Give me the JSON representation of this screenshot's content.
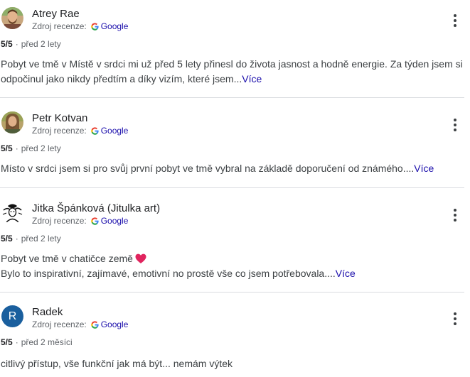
{
  "common": {
    "source_label": "Zdroj recenze:",
    "google_label": "Google",
    "more_label": "Více",
    "colors": {
      "link": "#1a0dab",
      "text": "#202124",
      "secondary": "#5f6368",
      "avatar_radek": "#1a5f9e"
    }
  },
  "reviews": [
    {
      "name": "Atrey Rae",
      "rating": "5/5",
      "time": "před 2 lety",
      "text_line1": "Pobyt ve tmě v Místě v srdci mi už před 5 lety přinesl do života jasnost a hodně energie. Za týden jsem si",
      "text_line2": "odpočinul jako nikdy předtím a díky vizím, které jsem",
      "ellipsis": "...",
      "avatar_icon": "man-beard-photo"
    },
    {
      "name": "Petr Kotvan",
      "rating": "5/5",
      "time": "před 2 lety",
      "text_line1": "Místo v srdci jsem si pro svůj první pobyt ve tmě vybral na základě doporučení od známého.",
      "ellipsis": "...",
      "avatar_icon": "man-long-hair-photo"
    },
    {
      "name": "Jitka Špánková (Jitulka art)",
      "rating": "5/5",
      "time": "před 2 lety",
      "text_line1": "Pobyt ve tmě v chatičce země",
      "text_line2": "Bylo to inspirativní, zajímavé, emotivní no prostě vše co jsem potřebovala.",
      "ellipsis": "...",
      "avatar_icon": "ink-drawing-avatar",
      "emoji_icon": "red-heart-icon"
    },
    {
      "name": "Radek",
      "rating": "5/5",
      "time": "před 2 měsíci",
      "text_line1": "citlivý přístup, vše funkční jak má být... nemám výtek",
      "avatar_letter": "R"
    }
  ]
}
